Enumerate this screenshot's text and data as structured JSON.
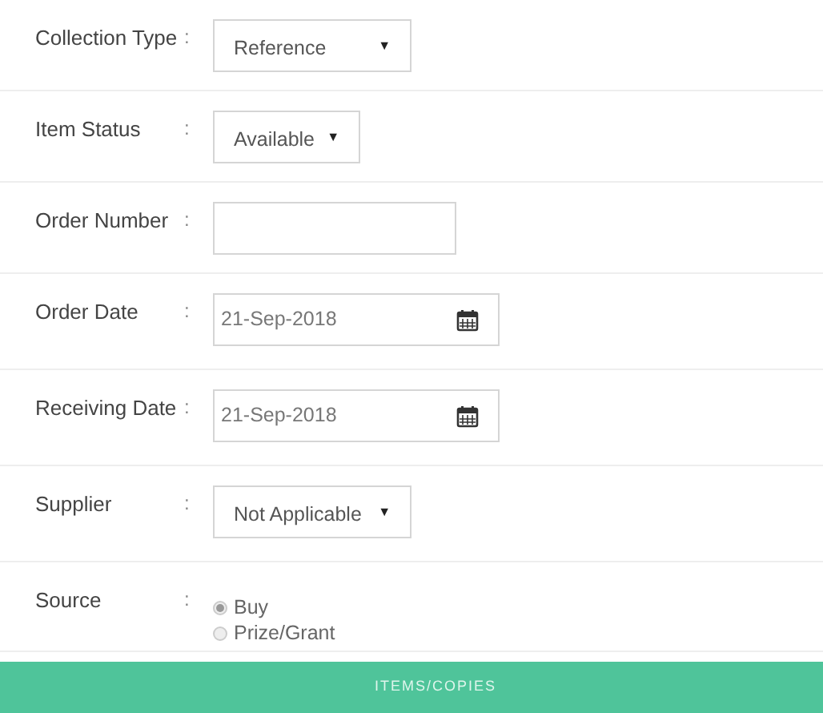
{
  "fields": [
    {
      "kind": "select",
      "label": "Collection Type",
      "separator": ":",
      "value": "Reference",
      "caret": "▼"
    },
    {
      "kind": "compactselect",
      "label": "Item Status",
      "separator": ":",
      "value": "Available",
      "caret": "▼"
    },
    {
      "kind": "input",
      "label": "Order Number",
      "separator": ":"
    },
    {
      "kind": "date",
      "label": "Order Date",
      "separator": ":",
      "value": "21-Sep-2018"
    },
    {
      "kind": "date",
      "label": "Receiving Date",
      "separator": ":",
      "value": "21-Sep-2018"
    },
    {
      "kind": "select",
      "label": "Supplier",
      "separator": ":",
      "value": "Not Applicable",
      "caret": "▼"
    },
    {
      "kind": "radio",
      "label": "Source",
      "separator": ":",
      "options": [
        {
          "label": "Buy",
          "selected": true
        },
        {
          "label": "Prize/Grant",
          "selected": false
        }
      ]
    }
  ],
  "section_bar": {
    "title": "ITEMS/COPIES"
  }
}
